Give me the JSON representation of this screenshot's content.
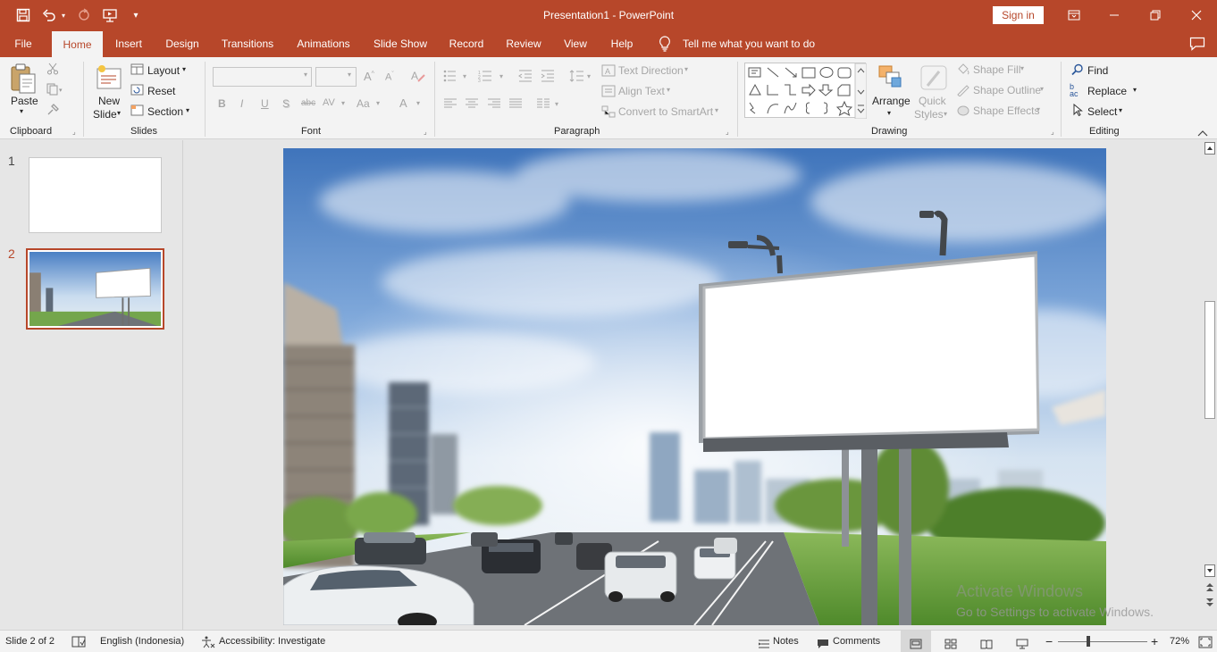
{
  "titlebar": {
    "title": "Presentation1  -  PowerPoint",
    "sign_in": "Sign in",
    "icons": [
      "save-icon",
      "undo-icon",
      "redo-icon",
      "start-from-beginning-icon",
      "customize-quick-access-icon"
    ]
  },
  "tabs": [
    "File",
    "Home",
    "Insert",
    "Design",
    "Transitions",
    "Animations",
    "Slide Show",
    "Record",
    "Review",
    "View",
    "Help"
  ],
  "active_tab": "Home",
  "tell_me": "Tell me what you want to do",
  "ribbon": {
    "clipboard": {
      "paste": "Paste",
      "label": "Clipboard"
    },
    "slides": {
      "new_slide": "New",
      "new_slide2": "Slide",
      "layout": "Layout",
      "reset": "Reset",
      "section": "Section",
      "label": "Slides"
    },
    "font": {
      "label": "Font",
      "bold": "B",
      "italic": "I",
      "underline": "U",
      "shadow": "S",
      "strike": "abc",
      "spacing": "AV",
      "case": "Aa",
      "color": "A"
    },
    "paragraph": {
      "text_direction": "Text Direction",
      "align_text": "Align Text",
      "smartart": "Convert to SmartArt",
      "label": "Paragraph"
    },
    "drawing": {
      "arrange": "Arrange",
      "quick_styles": "Quick",
      "quick_styles2": "Styles",
      "shape_fill": "Shape Fill",
      "shape_outline": "Shape Outline",
      "shape_effects": "Shape Effects",
      "label": "Drawing"
    },
    "editing": {
      "find": "Find",
      "replace": "Replace",
      "select": "Select",
      "label": "Editing"
    }
  },
  "thumbnails": [
    {
      "number": "1",
      "selected": false
    },
    {
      "number": "2",
      "selected": true
    }
  ],
  "watermark": {
    "line1": "Activate Windows",
    "line2": "Go to Settings to activate Windows."
  },
  "statusbar": {
    "slide_info": "Slide 2 of 2",
    "language": "English (Indonesia)",
    "accessibility": "Accessibility: Investigate",
    "notes": "Notes",
    "comments": "Comments",
    "zoom": "72%"
  },
  "colors": {
    "accent": "#b7472a",
    "ribbon_bg": "#f3f3f3",
    "workspace_bg": "#e6e6e6"
  }
}
